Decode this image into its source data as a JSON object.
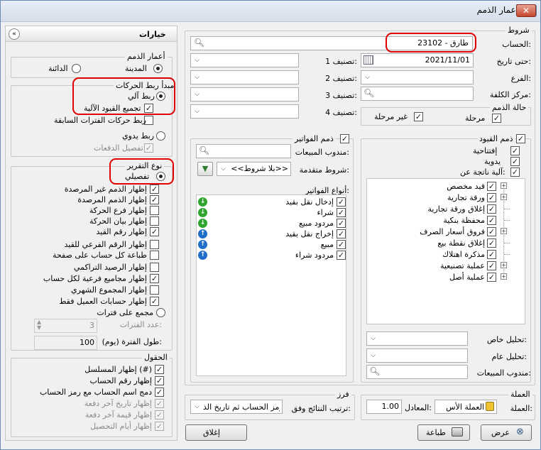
{
  "window": {
    "title": "أعمار الذمم"
  },
  "options_panel": {
    "header": "خيارات",
    "debt_age": {
      "label": "أعمار الذمم",
      "city_label": "المدينة",
      "creditor_label": "الدائنة"
    },
    "link_principle": {
      "label": "مبدأ ربط الحركات",
      "auto_link": "ربط آلي",
      "combine_auto_entries": "تجميع القيود الآلية",
      "link_previous_periods": "ربط حركات الفترات السابقة",
      "manual_link": "ربط يدوي",
      "payment_details": "تفصيل الدفعات"
    },
    "report_type": {
      "label": "نوع التقرير",
      "detailed": "تفصيلي",
      "show_unposted": "إظهار الذمم غير المرصدة",
      "show_posted": "إظهار الذمم المرصدة",
      "show_branch": "إظهار فرع الحركة",
      "show_statement": "إظهار بيان الحركة",
      "show_entry_number": "إظهار رقم القيد",
      "show_sub_number": "إظهار الرقم الفرعي للقيد",
      "print_per_page": "طباعة كل حساب على صفحة",
      "show_cumulative": "إظهار الرصيد التراكمي",
      "show_subtotals": "إظهار مجاميع فرعية لكل حساب",
      "show_monthly_total": "إظهار المجموع الشهري",
      "show_customer_only": "إظهار حسابات العميل فقط",
      "grouped_by_periods": "مجمع على فترات",
      "periods_count_label": "عدد الفترات:",
      "periods_count_value": "3",
      "period_length_label": "طول الفترة (يوم):",
      "period_length_value": "100"
    },
    "fields": {
      "label": "الحقول",
      "show_serial": "إظهار المسلسل (#)",
      "show_account_number": "إظهار رقم الحساب",
      "merge_account_name": "دمج اسم الحساب مع رمز الحساب",
      "show_last_payment_date": "إظهار تاريخ آخر دفعة",
      "show_last_payment_value": "إظهار قيمة آخر دفعة",
      "show_collection_days": "إظهار أيام التحصيل"
    }
  },
  "conditions": {
    "label": "شروط",
    "account_label": "الحساب:",
    "account_value": "23102 - طارق",
    "until_date_label": "حتى تاريخ:",
    "until_date_value": "2021/11/01",
    "branch_label": "الفرع:",
    "cost_center_label": "مركز الكلفة:",
    "class1_label": "تصنيف 1:",
    "class2_label": "تصنيف 2:",
    "class3_label": "تصنيف 3:",
    "class4_label": "تصنيف 4:",
    "debt_status": {
      "label": "حالة الذمم",
      "posted": "مرحلة",
      "unposted": "غير مرحلة"
    }
  },
  "invoice_debts": {
    "label": "ذمم الفواتير",
    "sales_rep_label": "مندوب المبيعات:",
    "advanced_label": "شروط متقدمة:",
    "advanced_value": "<<بلا شروط>>",
    "types_label": "أنواع الفواتير:",
    "types": [
      {
        "label": "إدخال نقل بقيد",
        "dir": "down",
        "color": "#2fa52f"
      },
      {
        "label": "شراء",
        "dir": "down",
        "color": "#2fa52f"
      },
      {
        "label": "مردود مبيع",
        "dir": "down",
        "color": "#2fa52f"
      },
      {
        "label": "إخراج نقل بقيد",
        "dir": "up",
        "color": "#1f6fc9"
      },
      {
        "label": "مبيع",
        "dir": "up",
        "color": "#1f6fc9"
      },
      {
        "label": "مردود شراء",
        "dir": "up",
        "color": "#1f6fc9"
      }
    ]
  },
  "entry_debts": {
    "label": "ذمم القيود",
    "opening": "إفتتاحية",
    "manual": "يدوية",
    "auto_from": "آلية ناتجة عن:",
    "tree": [
      {
        "label": "قيد مخصص",
        "plus": true
      },
      {
        "label": "ورقة تجارية",
        "plus": true
      },
      {
        "label": "إغلاق ورقة تجارية",
        "plus": false
      },
      {
        "label": "محفظة بنكية",
        "plus": false
      },
      {
        "label": "فروق أسعار الصرف",
        "plus": true
      },
      {
        "label": "إغلاق نقطة بيع",
        "plus": false
      },
      {
        "label": "مذكرة اهتلاك",
        "plus": false
      },
      {
        "label": "عملية تصنيعية",
        "plus": true
      },
      {
        "label": "عملية أصل",
        "plus": true
      }
    ],
    "special_analysis_label": "تحليل خاص:",
    "general_analysis_label": "تحليل عام:",
    "sales_rep_label": "مندوب المبيعات:"
  },
  "currency": {
    "label": "العملة",
    "currency_label": "العملة:",
    "currency_value": "العملة الأس",
    "rate_label": "المعادل:",
    "rate_value": "1.00"
  },
  "sort": {
    "label": "فرز",
    "order_label": "ترتيب النتائج وفق:",
    "order_value": "رمز الحساب ثم تاريخ الذ"
  },
  "buttons": {
    "view": "عرض",
    "print": "طباعة",
    "close": "إغلاق"
  }
}
